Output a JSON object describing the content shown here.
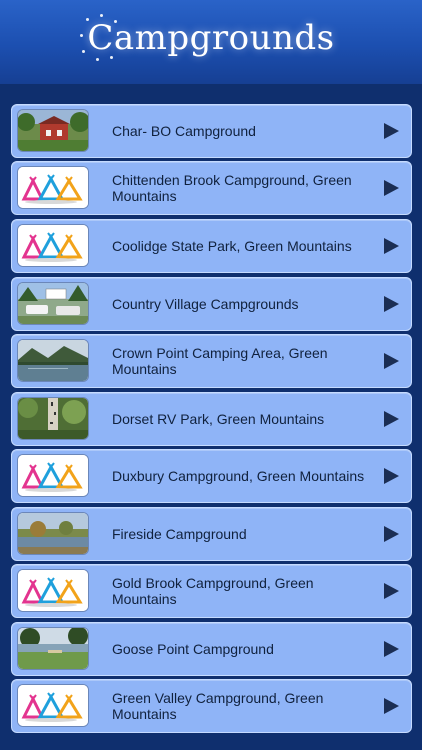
{
  "header": {
    "title": "Campgrounds",
    "bg_color": "#1c4fb0"
  },
  "items": [
    {
      "label": "Char- BO Campground",
      "thumb": "photo-red-house-icon"
    },
    {
      "label": "Chittenden Brook Campground, Green Mountains",
      "thumb": "tent-logo-icon"
    },
    {
      "label": "Coolidge State Park, Green Mountains",
      "thumb": "tent-logo-icon"
    },
    {
      "label": "Country Village Campgrounds",
      "thumb": "photo-rv-park-icon"
    },
    {
      "label": "Crown Point Camping Area, Green Mountains",
      "thumb": "photo-lake-icon"
    },
    {
      "label": "Dorset RV Park, Green Mountains",
      "thumb": "photo-forest-icon"
    },
    {
      "label": "Duxbury Campground, Green Mountains",
      "thumb": "tent-logo-icon"
    },
    {
      "label": "Fireside Campground",
      "thumb": "photo-riverside-icon"
    },
    {
      "label": "Gold Brook Campground, Green Mountains",
      "thumb": "tent-logo-icon"
    },
    {
      "label": "Goose Point Campground",
      "thumb": "photo-lakeshore-icon"
    },
    {
      "label": "Green Valley Campground, Green Mountains",
      "thumb": "tent-logo-icon"
    }
  ],
  "colors": {
    "row_bg": "#8fb4f7",
    "page_bg": "#0f2f6e",
    "arrow": "#1b2e54"
  }
}
